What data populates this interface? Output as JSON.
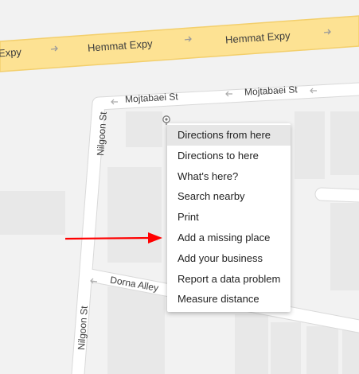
{
  "roads": {
    "expressway_label": "Hemmat Expy",
    "expressway_label_left": "Expy",
    "mojtabaei_label": "Mojtabaei St",
    "nilgoon_label": "Nilgoon St",
    "dorna_label": "Dorna Alley"
  },
  "context_menu": {
    "items": [
      {
        "label": "Directions from here"
      },
      {
        "label": "Directions to here"
      },
      {
        "label": "What's here?"
      },
      {
        "label": "Search nearby"
      },
      {
        "label": "Print"
      },
      {
        "label": "Add a missing place"
      },
      {
        "label": "Add your business"
      },
      {
        "label": "Report a data problem"
      },
      {
        "label": "Measure distance"
      }
    ],
    "hovered_index": 0
  },
  "colors": {
    "background": "#f2f2f2",
    "block": "#e8e8e8",
    "road": "#ffffff",
    "road_edge": "#d9d9d9",
    "expressway_fill": "#fde293",
    "expressway_edge": "#f3cf6c",
    "arrow": "#ff0000"
  },
  "icons": {
    "pin": "map-pin-icon",
    "oneway": "oneway-arrow-icon"
  }
}
